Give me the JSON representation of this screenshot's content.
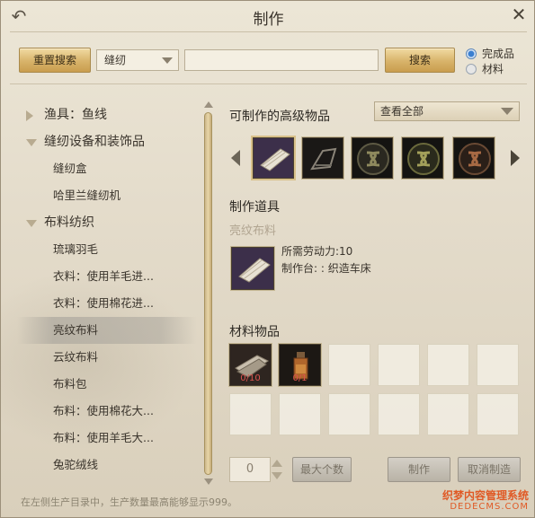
{
  "window": {
    "title": "制作"
  },
  "search": {
    "reset_label": "重置搜索",
    "category_value": "缝纫",
    "query_value": "",
    "search_label": "搜索",
    "radio_finished": "完成品",
    "radio_material": "材料"
  },
  "tree": {
    "items": [
      {
        "label": "渔具：鱼线",
        "kind": "category",
        "expanded": false
      },
      {
        "label": "缝纫设备和装饰品",
        "kind": "category",
        "expanded": true
      },
      {
        "label": "缝纫盒",
        "kind": "leaf"
      },
      {
        "label": "哈里兰缝纫机",
        "kind": "leaf"
      },
      {
        "label": "布料纺织",
        "kind": "category",
        "expanded": true
      },
      {
        "label": "琉璃羽毛",
        "kind": "leaf"
      },
      {
        "label": "衣料：使用羊毛进...",
        "kind": "leaf"
      },
      {
        "label": "衣料：使用棉花进...",
        "kind": "leaf"
      },
      {
        "label": "亮纹布料",
        "kind": "leaf",
        "selected": true
      },
      {
        "label": "云纹布料",
        "kind": "leaf"
      },
      {
        "label": "布料包",
        "kind": "leaf"
      },
      {
        "label": "布料：使用棉花大...",
        "kind": "leaf"
      },
      {
        "label": "布料：使用羊毛大...",
        "kind": "leaf"
      },
      {
        "label": "兔驼绒线",
        "kind": "leaf"
      }
    ]
  },
  "advanced": {
    "title": "可制作的高级物品",
    "view_select": "查看全部",
    "items": [
      {
        "icon": "cloth-roll-icon"
      },
      {
        "icon": "sewing-machine-icon"
      },
      {
        "icon": "knot-emblem-gold-icon"
      },
      {
        "icon": "knot-emblem-olive-icon"
      },
      {
        "icon": "knot-emblem-copper-icon"
      }
    ]
  },
  "tool": {
    "title": "制作道具",
    "name": "亮纹布料",
    "labor": "所需劳动力:10",
    "station": "制作台: : 织造车床"
  },
  "materials": {
    "title": "材料物品",
    "items": [
      {
        "icon": "cloth-bundle-icon",
        "count": "0/10"
      },
      {
        "icon": "dye-bottle-icon",
        "count": "0/1"
      }
    ]
  },
  "controls": {
    "quantity": "0",
    "max_label": "最大个数",
    "craft_label": "制作",
    "cancel_label": "取消制造"
  },
  "footer": {
    "hint": "在左侧生产目录中，生产数量最高能够显示999。",
    "watermark_line1": "织梦内容管理系统",
    "watermark_line2": "DEDECMS.COM"
  },
  "colors": {
    "accent_gold": "#d8b36a",
    "count_red": "#d9534f",
    "watermark": "#e05a26"
  }
}
